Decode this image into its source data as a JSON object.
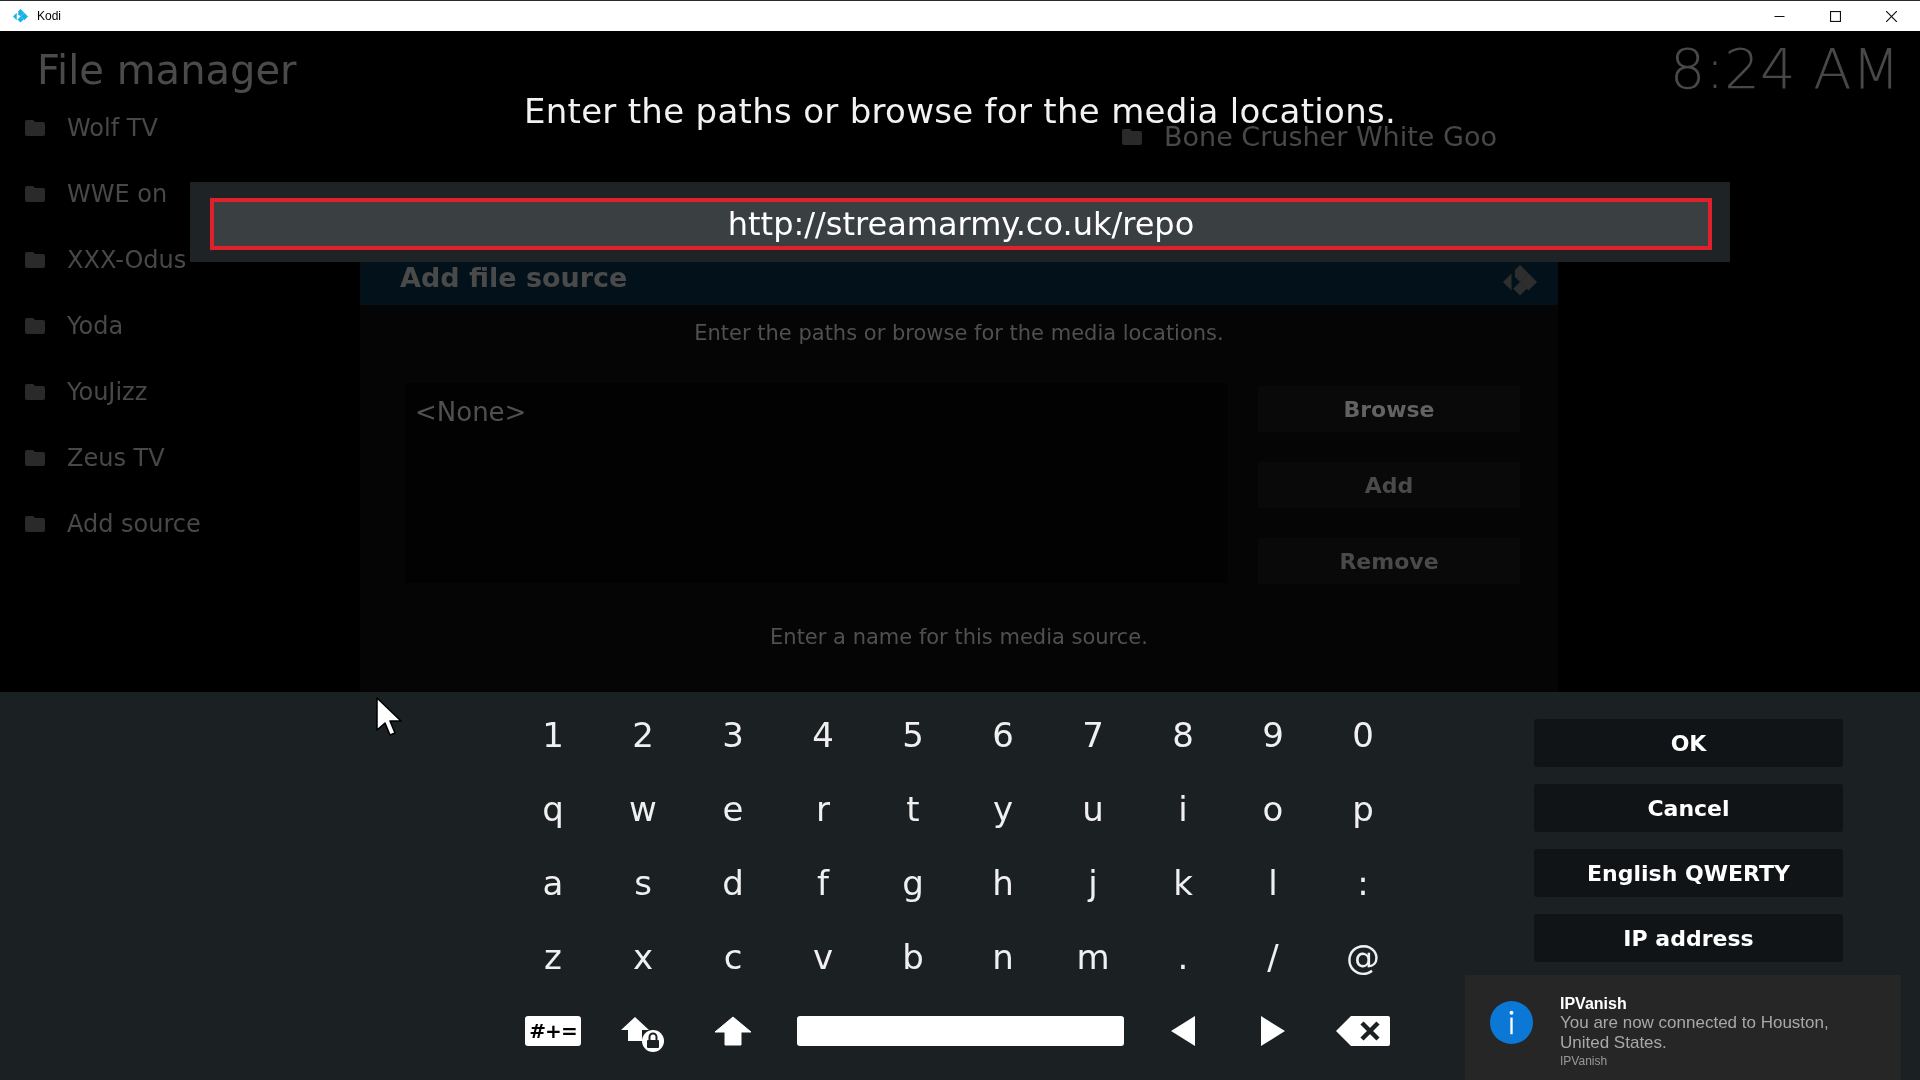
{
  "window": {
    "title": "Kodi"
  },
  "file_manager": {
    "title": "File manager",
    "clock": "8:24 AM",
    "left_sources": [
      "Wolf TV",
      "WWE on",
      "XXX-Odus",
      "Yoda",
      "YouJizz",
      "Zeus TV",
      "Add source"
    ],
    "right_sources": [
      "Bone Crusher White Goo"
    ]
  },
  "dialog": {
    "title": "Add file source",
    "prompt": "Enter the paths or browse for the media locations.",
    "paths": [
      "<None>"
    ],
    "buttons": [
      {
        "label": "Browse",
        "disabled": false
      },
      {
        "label": "Add",
        "disabled": true
      },
      {
        "label": "Remove",
        "disabled": true
      }
    ],
    "name_prompt": "Enter a name for this media source."
  },
  "keyboard": {
    "heading": "Enter the paths or browse for the media locations.",
    "input": {
      "value": "http://streamarmy.co.uk/repo",
      "focused": true
    },
    "rows": [
      [
        "1",
        "2",
        "3",
        "4",
        "5",
        "6",
        "7",
        "8",
        "9",
        "0"
      ],
      [
        "q",
        "w",
        "e",
        "r",
        "t",
        "y",
        "u",
        "i",
        "o",
        "p"
      ],
      [
        "a",
        "s",
        "d",
        "f",
        "g",
        "h",
        "j",
        "k",
        "l",
        ":"
      ],
      [
        "z",
        "x",
        "c",
        "v",
        "b",
        "n",
        "m",
        ".",
        "/",
        "@"
      ]
    ],
    "bottom_row": [
      {
        "kind": "symbols",
        "label": "#+="
      },
      {
        "kind": "caps_lock"
      },
      {
        "kind": "shift"
      },
      {
        "kind": "space"
      },
      {
        "kind": "left"
      },
      {
        "kind": "right"
      },
      {
        "kind": "backspace"
      }
    ],
    "actions": [
      "OK",
      "Cancel",
      "English QWERTY",
      "IP address"
    ]
  },
  "notification": {
    "title": "IPVanish",
    "message": "You are now connected to Houston, United States.",
    "source": "IPVanish"
  }
}
